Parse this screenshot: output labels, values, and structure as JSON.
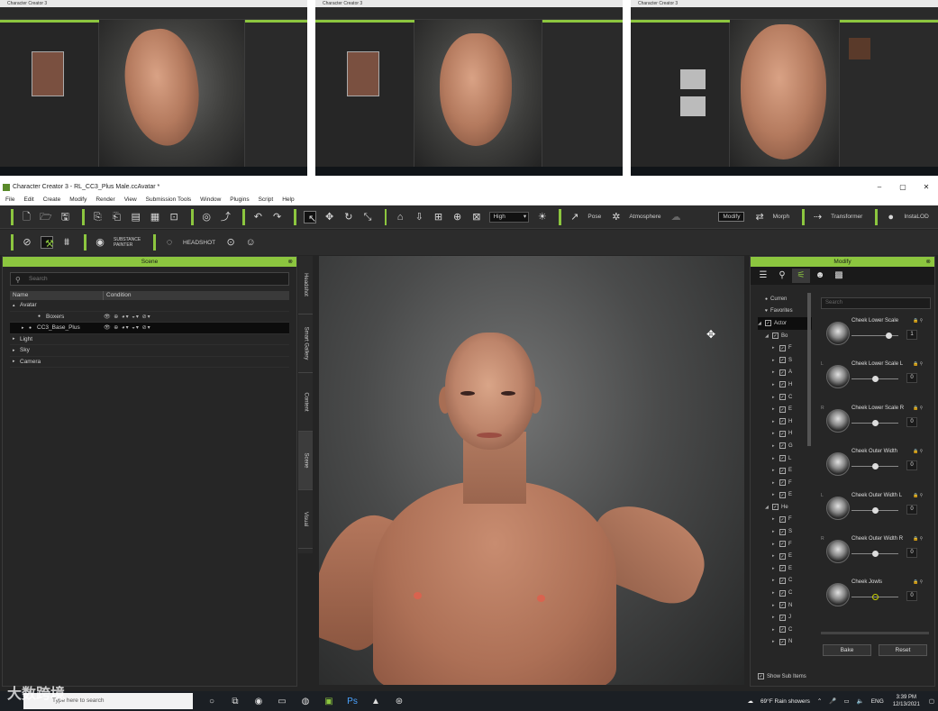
{
  "window": {
    "title": "Character Creator 3 - RL_CC3_Plus Male.ccAvatar *",
    "controls": [
      "–",
      "▢",
      "✕"
    ]
  },
  "menu": [
    "File",
    "Edit",
    "Create",
    "Modify",
    "Render",
    "View",
    "Submission Tools",
    "Window",
    "Plugins",
    "Script",
    "Help"
  ],
  "toolbar": {
    "quality": "High",
    "pose": "Pose",
    "atmosphere": "Atmosphere",
    "modify": "Modify",
    "morph": "Morph",
    "transformer": "Transformer",
    "instalod": "InstaLOD",
    "substance": "SUBSTANCE PAINTER",
    "headshot": "HEADSHOT"
  },
  "scene": {
    "title": "Scene",
    "search_placeholder": "Search",
    "col_name": "Name",
    "col_condition": "Condition",
    "rows": [
      {
        "label": "Avatar",
        "indent": 0,
        "arrow": "▴"
      },
      {
        "label": "Boxers",
        "indent": 2,
        "arrow": ""
      },
      {
        "label": "CC3_Base_Plus",
        "indent": 1,
        "arrow": "▸",
        "selected": true
      },
      {
        "label": "Light",
        "indent": 0,
        "arrow": "▸"
      },
      {
        "label": "Sky",
        "indent": 0,
        "arrow": "▸"
      },
      {
        "label": "Camera",
        "indent": 0,
        "arrow": "▸"
      }
    ]
  },
  "side_tabs": [
    "Headshot",
    "Smart Gallery",
    "Content",
    "Scene",
    "Visual"
  ],
  "modify": {
    "title": "Modify",
    "search_placeholder": "Search",
    "tree": [
      {
        "label": "Curren",
        "type": "dot"
      },
      {
        "label": "Favorites",
        "type": "heart"
      },
      {
        "label": "Actor",
        "type": "check",
        "selected": true
      },
      {
        "label": "Bo",
        "type": "check"
      },
      {
        "label": "F",
        "type": "sub"
      },
      {
        "label": "S",
        "type": "sub"
      },
      {
        "label": "A",
        "type": "sub"
      },
      {
        "label": "H",
        "type": "sub"
      },
      {
        "label": "C",
        "type": "sub"
      },
      {
        "label": "E",
        "type": "sub"
      },
      {
        "label": "H",
        "type": "sub"
      },
      {
        "label": "H",
        "type": "sub"
      },
      {
        "label": "G",
        "type": "sub"
      },
      {
        "label": "L",
        "type": "sub"
      },
      {
        "label": "E",
        "type": "sub"
      },
      {
        "label": "F",
        "type": "sub"
      },
      {
        "label": "E",
        "type": "sub"
      },
      {
        "label": "He",
        "type": "check"
      },
      {
        "label": "F",
        "type": "sub"
      },
      {
        "label": "S",
        "type": "sub"
      },
      {
        "label": "F",
        "type": "sub"
      },
      {
        "label": "E",
        "type": "sub"
      },
      {
        "label": "E",
        "type": "sub"
      },
      {
        "label": "C",
        "type": "sub"
      },
      {
        "label": "C",
        "type": "sub"
      },
      {
        "label": "N",
        "type": "sub"
      },
      {
        "label": "J",
        "type": "sub"
      },
      {
        "label": "C",
        "type": "sub"
      },
      {
        "label": "N",
        "type": "sub"
      }
    ],
    "sliders": [
      {
        "label": "Cheek Lower Scale",
        "prefix": "",
        "value": "1",
        "pos": 0.8
      },
      {
        "label": "Cheek Lower Scale L",
        "prefix": "L",
        "value": "0",
        "pos": 0.5
      },
      {
        "label": "Cheek Lower Scale R",
        "prefix": "R",
        "value": "0",
        "pos": 0.5
      },
      {
        "label": "Cheek Outer Width",
        "prefix": "",
        "value": "0",
        "pos": 0.5
      },
      {
        "label": "Cheek Outer Width L",
        "prefix": "L",
        "value": "0",
        "pos": 0.5
      },
      {
        "label": "Cheek Outer Width R",
        "prefix": "R",
        "value": "0",
        "pos": 0.5
      },
      {
        "label": "Cheek Jowls",
        "prefix": "",
        "value": "0",
        "pos": 0.5
      }
    ],
    "bake": "Bake",
    "reset": "Reset",
    "show_sub": "Show Sub Items"
  },
  "taskbar": {
    "search_placeholder": "Type here to search",
    "weather": "69°F  Rain showers",
    "lang": "ENG",
    "time": "3:39 PM",
    "date": "12/13/2021"
  },
  "watermark": "大数跨境",
  "thumbnails": [
    {
      "title": "Character Creator 3"
    },
    {
      "title": "Character Creator 3"
    },
    {
      "title": "Character Creator 3"
    }
  ],
  "colors": {
    "accent": "#8cc63f",
    "panel": "#262626"
  }
}
